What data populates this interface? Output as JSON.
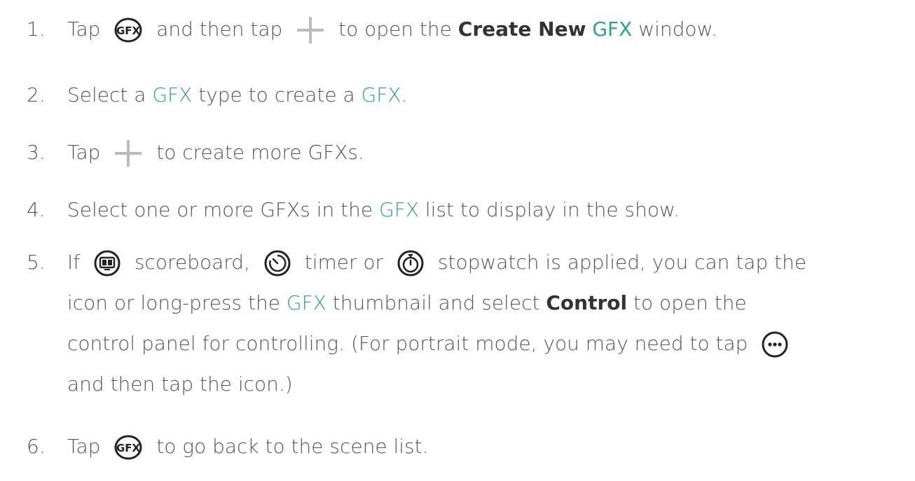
{
  "steps": [
    {
      "num": "1.",
      "parts": [
        "Tap",
        "and then tap",
        "to open the",
        "Create New",
        "GFX",
        "window."
      ]
    },
    {
      "num": "2.",
      "parts": [
        "Select a",
        "GFX",
        "type to create a",
        "GFX",
        "."
      ]
    },
    {
      "num": "3.",
      "parts": [
        "Tap",
        "to create more GFXs."
      ]
    },
    {
      "num": "4.",
      "parts": [
        "Select one or more GFXs in the",
        "GFX",
        "list to display in the show."
      ]
    },
    {
      "num": "5.",
      "parts": [
        "If",
        "scoreboard,",
        "timer or",
        "stopwatch is applied, you can tap the",
        "icon or long-press the",
        "GFX",
        "thumbnail and select",
        "Control",
        "to open the",
        "control panel for controlling. (For portrait mode, you may need to tap",
        "and then tap the icon.)"
      ]
    },
    {
      "num": "6.",
      "parts": [
        "Tap",
        "to go back to the scene list."
      ]
    }
  ],
  "icons": {
    "gfx": "gfx-icon",
    "plus": "plus-icon",
    "scoreboard": "scoreboard-icon",
    "timer": "timer-icon",
    "stopwatch": "stopwatch-icon",
    "more": "more-icon"
  },
  "colors": {
    "text": "#555555",
    "highlight": "#2aa394",
    "plus": "#bbbbbb"
  }
}
